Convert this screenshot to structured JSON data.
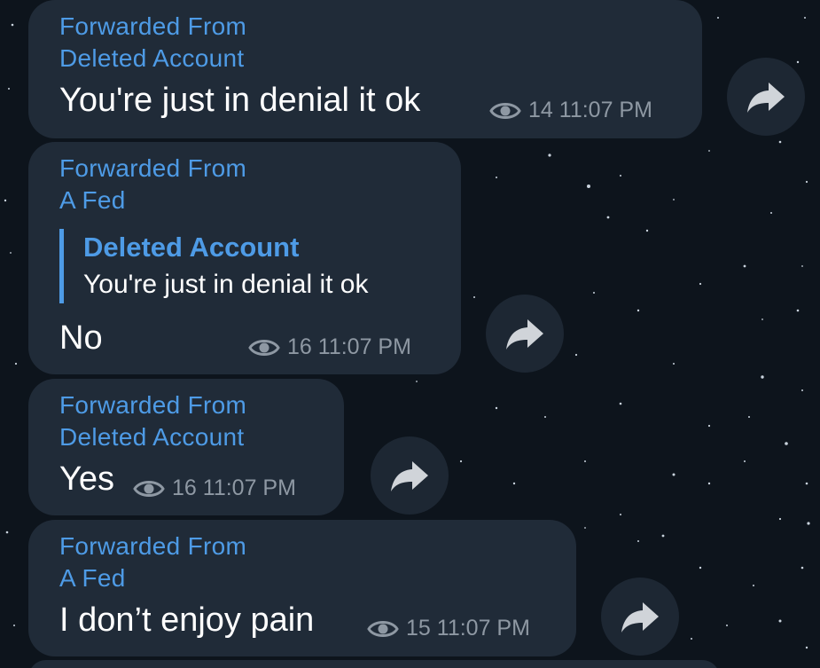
{
  "messages": [
    {
      "forwarded_label": "Forwarded From",
      "forwarded_from": "Deleted Account",
      "text": "You're just in denial it ok",
      "views": "14",
      "time": "11:07 PM"
    },
    {
      "forwarded_label": "Forwarded From",
      "forwarded_from": "A Fed",
      "reply": {
        "name": "Deleted Account",
        "text": "You're just in denial it ok"
      },
      "text": "No",
      "views": "16",
      "time": "11:07 PM"
    },
    {
      "forwarded_label": "Forwarded From",
      "forwarded_from": "Deleted Account",
      "text": "Yes",
      "views": "16",
      "time": "11:07 PM"
    },
    {
      "forwarded_label": "Forwarded From",
      "forwarded_from": "A Fed",
      "text": "I don’t enjoy pain",
      "views": "15",
      "time": "11:07 PM"
    }
  ],
  "icons": {
    "views": "eye-icon",
    "share": "share-arrow-icon"
  },
  "colors": {
    "background": "#0d141c",
    "bubble": "#202b38",
    "accent": "#4e9be6",
    "meta": "#8e98a3",
    "text": "#ffffff"
  }
}
